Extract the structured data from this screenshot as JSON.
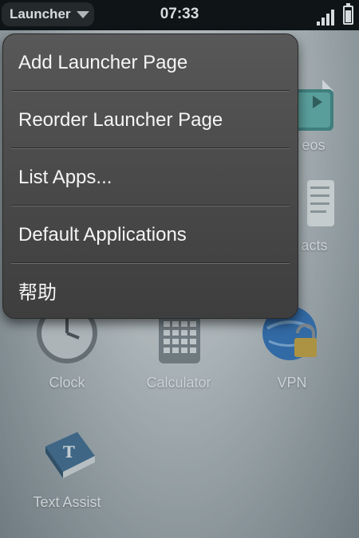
{
  "status_bar": {
    "app_menu_label": "Launcher",
    "time": "07:33",
    "icons": [
      "signal-icon",
      "battery-icon"
    ]
  },
  "app_menu": {
    "items": [
      "Add Launcher Page",
      "Reorder Launcher Page",
      "List Apps...",
      "Default Applications",
      "帮助"
    ]
  },
  "launcher": {
    "apps": [
      {
        "label": "eos",
        "icon": "videos-icon"
      },
      {
        "label": "acts",
        "icon": "contacts-icon"
      },
      {
        "label": "Clock",
        "icon": "clock-icon"
      },
      {
        "label": "Calculator",
        "icon": "calculator-icon"
      },
      {
        "label": "VPN",
        "icon": "vpn-icon"
      },
      {
        "label": "Text Assist",
        "icon": "text-assist-icon"
      }
    ],
    "next_page_icon": "chevron-right-icon"
  },
  "colors": {
    "menu_bg": "#4a4a4a",
    "status_bar_bg": "#000000",
    "launcher_bg": "#c9ced0"
  }
}
